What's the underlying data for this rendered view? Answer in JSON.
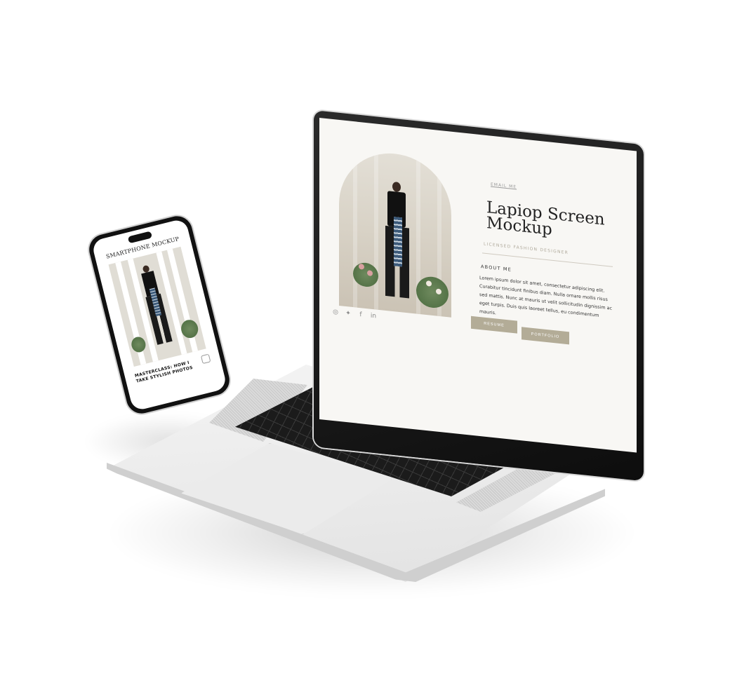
{
  "laptop_screen": {
    "email_link": "EMAIL ME",
    "title": "Lapiop Screen Mockup",
    "subtitle": "LICENSED FASHION DESIGNER",
    "about_heading": "ABOUT ME",
    "about_text": "Lorem ipsum dolor sit amet, consectetur adipiscing elit. Curabitur tincidunt finibus diam. Nulla ornare mollis risus sed mattis. Nunc at mauris ut velit sollicitudin dignissim ac eget turpis. Duis quis laoreet tellus, eu condimentum mauris.",
    "buttons": {
      "resume": "RESUME",
      "portfolio": "PORTFOLIO"
    },
    "social_icons": [
      "instagram-icon",
      "twitter-icon",
      "facebook-icon",
      "linkedin-icon"
    ],
    "accent_color": "#b3ac97"
  },
  "phone_screen": {
    "title": "SMARTPHONE MOCKUP",
    "caption": "MASTERCLASS: HOW I TAKE STYLISH PHOTOS"
  }
}
